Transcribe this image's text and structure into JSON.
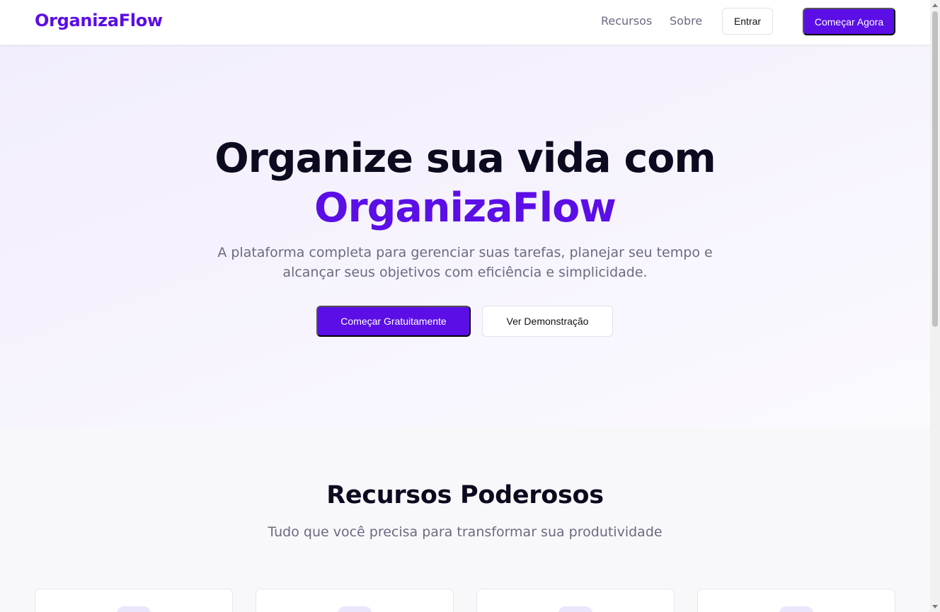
{
  "navbar": {
    "logo": "OrganizaFlow",
    "links": [
      "Recursos",
      "Sobre"
    ],
    "login_label": "Entrar",
    "cta_label": "Começar Agora"
  },
  "hero": {
    "title_line1": "Organize sua vida com",
    "title_accent": "OrganizaFlow",
    "subtitle": "A plataforma completa para gerenciar suas tarefas, planejar seu tempo e alcançar seus objetivos com eficiência e simplicidade.",
    "primary_button": "Começar Gratuitamente",
    "secondary_button": "Ver Demonstração"
  },
  "features": {
    "title": "Recursos Poderosos",
    "subtitle": "Tudo que você precisa para transformar sua produtividade"
  },
  "colors": {
    "brand": "#5b0ee6",
    "text_dark": "#0c0a1e",
    "text_muted": "#6b6a80",
    "icon_bg": "#ece6fc"
  }
}
